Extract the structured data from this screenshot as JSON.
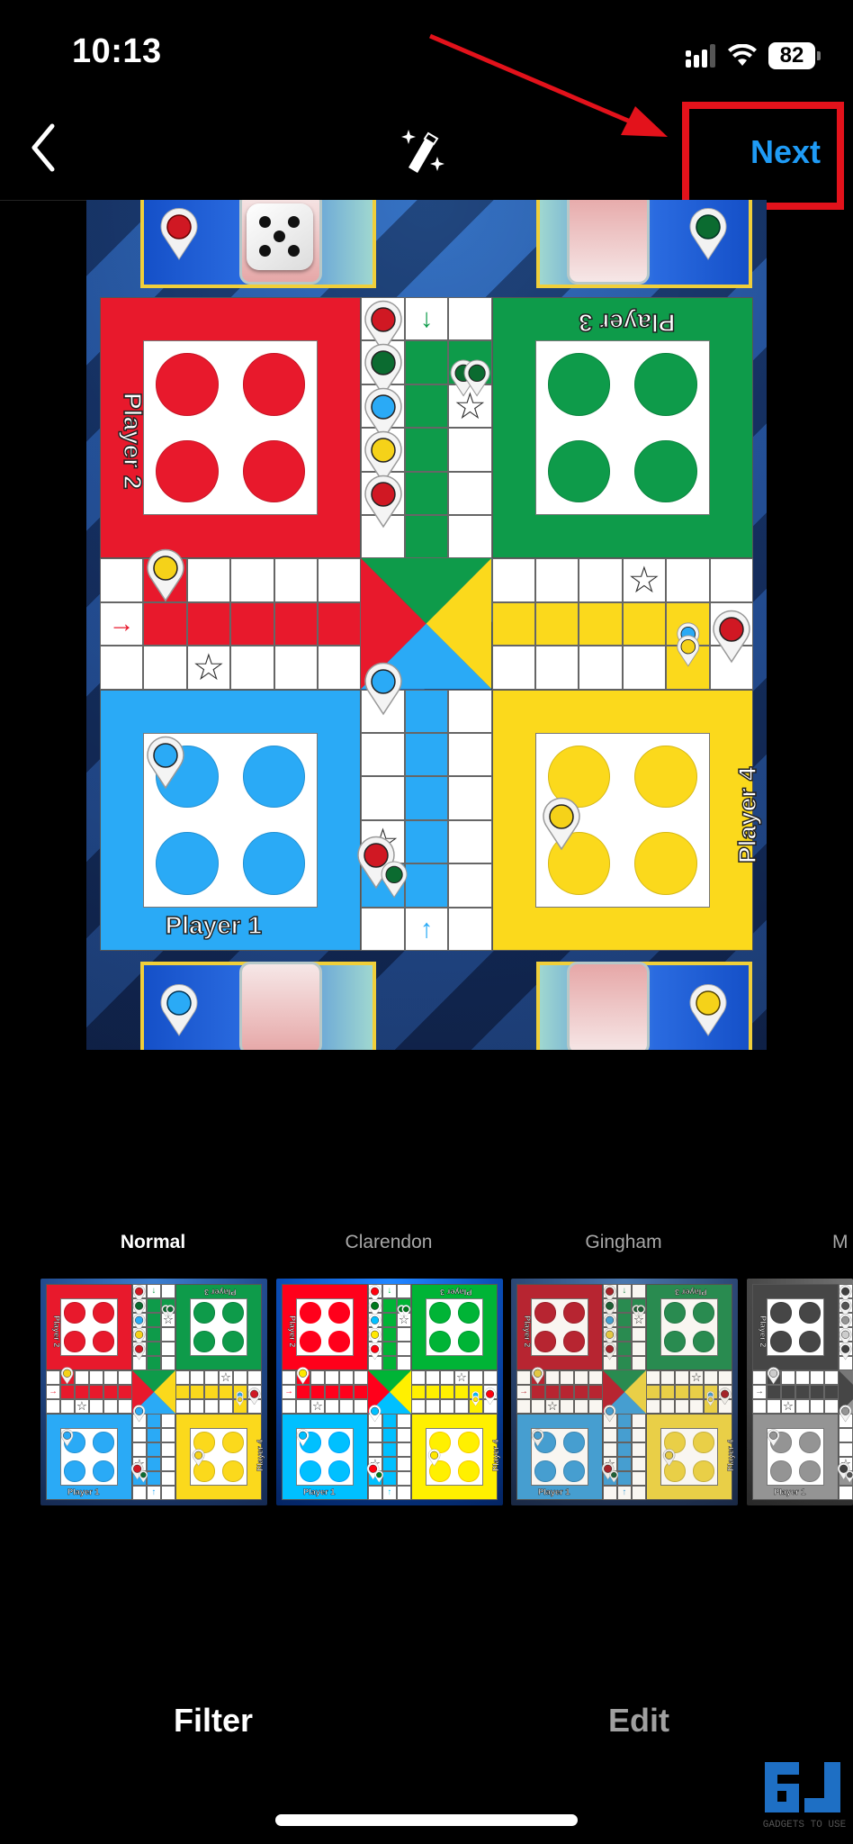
{
  "status_bar": {
    "time": "10:13",
    "battery_percent": "82",
    "icons": [
      "cellular-signal-icon",
      "wifi-icon",
      "battery-icon"
    ]
  },
  "nav": {
    "back_icon": "chevron-left-icon",
    "magic_icon": "magic-wand-icon",
    "next_label": "Next"
  },
  "annotation": {
    "color": "#e3121b",
    "target": "Next"
  },
  "preview": {
    "type": "ludo-game-screenshot",
    "dice_value": 5,
    "players": [
      {
        "name": "Player 1",
        "color": "#2aaaf6",
        "corner": "bottom-left"
      },
      {
        "name": "Player 2",
        "color": "#e8192c",
        "corner": "top-left"
      },
      {
        "name": "Player 3",
        "color": "#0e9b4a",
        "corner": "top-right"
      },
      {
        "name": "Player 4",
        "color": "#fbd91c",
        "corner": "bottom-right"
      }
    ],
    "colors": {
      "red": "#e8192c",
      "green": "#0e9b4a",
      "blue": "#2aaaf6",
      "yellow": "#fbd91c"
    }
  },
  "filters": {
    "items": [
      {
        "label": "Normal",
        "selected": true
      },
      {
        "label": "Clarendon",
        "selected": false
      },
      {
        "label": "Gingham",
        "selected": false
      },
      {
        "label": "M",
        "selected": false
      }
    ]
  },
  "tabs": {
    "filter_label": "Filter",
    "edit_label": "Edit",
    "active": "Filter"
  },
  "watermark": {
    "text": "GADGETS TO USE"
  },
  "accent_color": "#1f9bf5"
}
